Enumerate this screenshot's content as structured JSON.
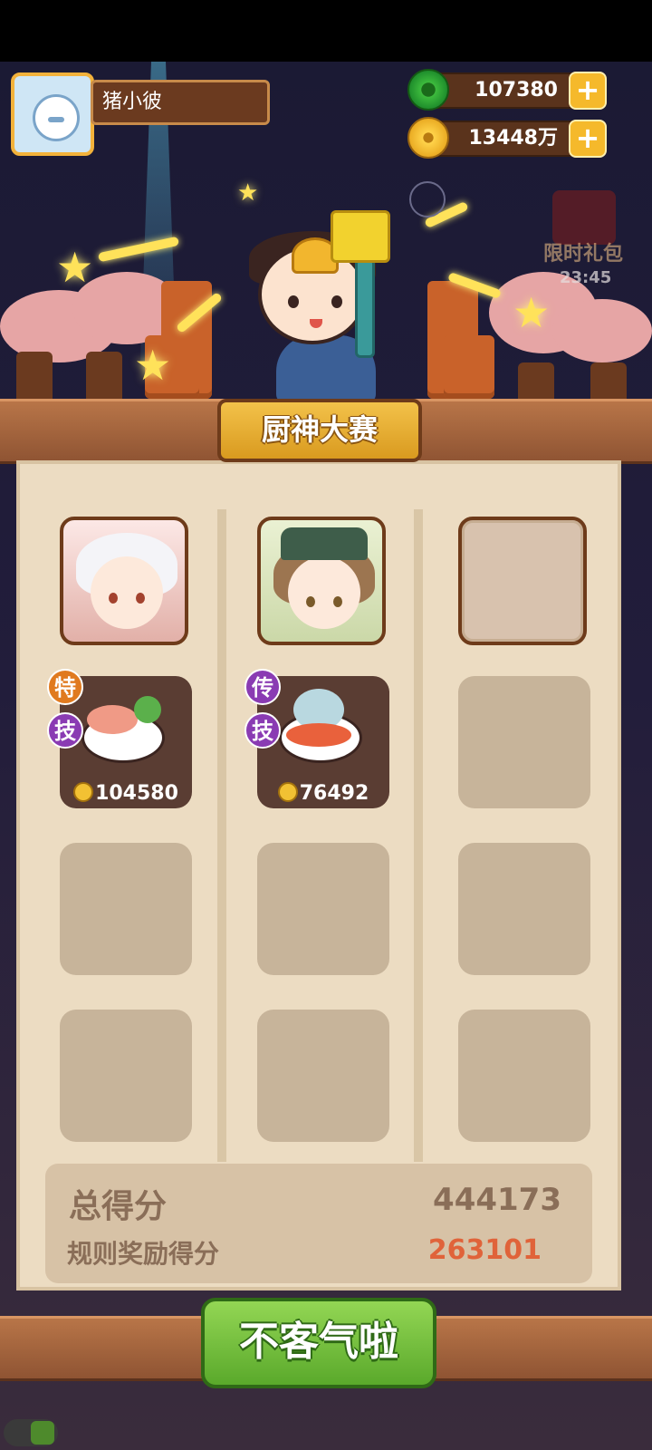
{
  "player": {
    "name": "猪小彼"
  },
  "currencies": {
    "jade": {
      "value": "107380",
      "icon": "jade-icon"
    },
    "coins": {
      "value": "13448万",
      "icon": "coin-icon"
    }
  },
  "promo": {
    "label": "限时礼包",
    "timer": "23:45"
  },
  "panel": {
    "title": "厨神大赛"
  },
  "columns": [
    {
      "chef": "chef-portrait-white-hair",
      "dish": {
        "tags": [
          "特",
          "技"
        ],
        "price": "104580"
      }
    },
    {
      "chef": "chef-portrait-scholar",
      "dish": {
        "tags": [
          "传",
          "技"
        ],
        "price": "76492"
      }
    },
    {
      "chef": null,
      "dish": null
    }
  ],
  "score": {
    "total_label": "总得分",
    "total_value": "444173",
    "bonus_label": "规则奖励得分",
    "bonus_value": "263101"
  },
  "confirm_label": "不客气啦",
  "colors": {
    "accent_green": "#5aa92b",
    "bonus_red": "#e0633a",
    "gold": "#f2c133"
  }
}
